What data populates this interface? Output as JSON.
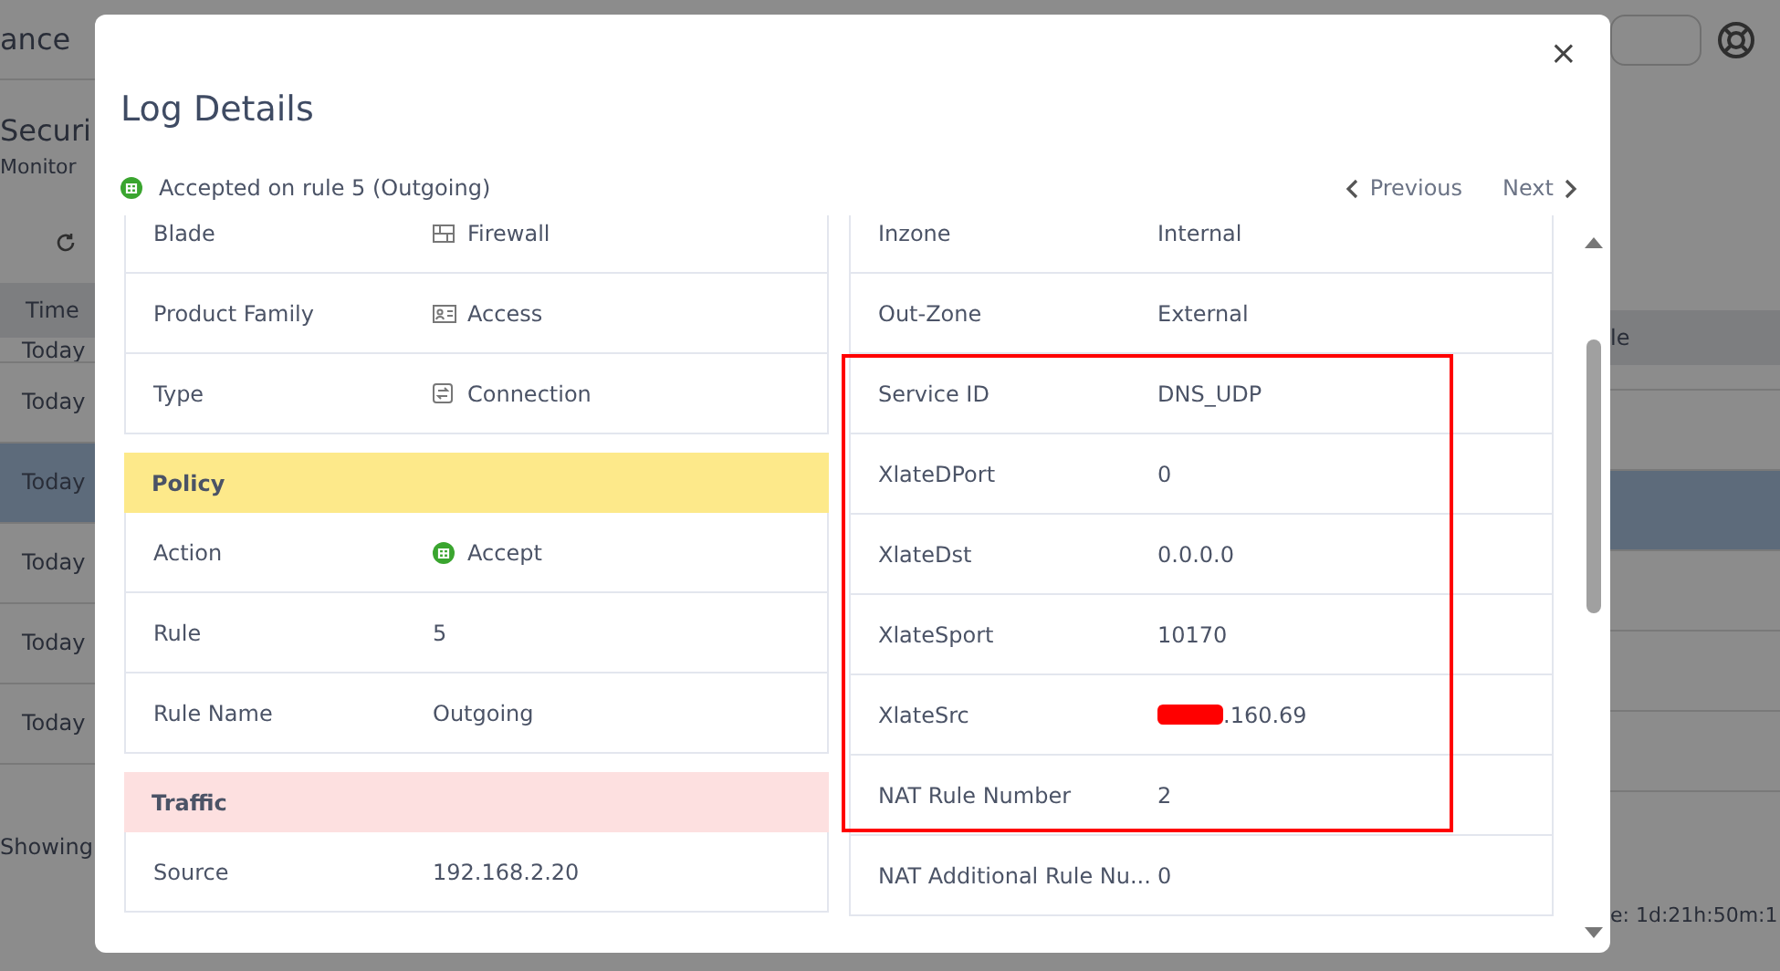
{
  "background": {
    "title": "ance",
    "heading": "Securi",
    "description": "Monitor",
    "column_1": "Time",
    "column_2": "le",
    "rows": [
      {
        "time": "Today",
        "selected": false
      },
      {
        "time": "Today",
        "selected": false
      },
      {
        "time": "Today",
        "selected": true
      },
      {
        "time": "Today",
        "selected": false
      },
      {
        "time": "Today",
        "selected": false
      },
      {
        "time": "Today",
        "selected": false
      }
    ],
    "footer": "Showing",
    "uptime": "e: 1d:21h:50m:1"
  },
  "dialog": {
    "title": "Log Details",
    "close": "×",
    "status": "Accepted on rule 5 (Outgoing)",
    "previous": "Previous",
    "next": "Next",
    "left": [
      {
        "kind": "row",
        "label": "Blade",
        "value": "Firewall",
        "icon": true
      },
      {
        "kind": "row",
        "label": "Product Family",
        "value": "Access",
        "icon": true
      },
      {
        "kind": "row",
        "label": "Type",
        "value": "Connection",
        "icon": true
      },
      {
        "kind": "header",
        "label": "Policy",
        "color": "#fde98a"
      },
      {
        "kind": "row",
        "label": "Action",
        "value": "Accept",
        "icon": true
      },
      {
        "kind": "row",
        "label": "Rule",
        "value": "5"
      },
      {
        "kind": "row",
        "label": "Rule Name",
        "value": "Outgoing"
      },
      {
        "kind": "header",
        "label": "Traffic",
        "color": "#fde0e0"
      },
      {
        "kind": "row",
        "label": "Source",
        "value": "192.168.2.20"
      }
    ],
    "right": [
      {
        "kind": "row",
        "label": "Inzone",
        "value": "Internal"
      },
      {
        "kind": "row",
        "label": "Out-Zone",
        "value": "External"
      },
      {
        "kind": "highlight",
        "rows": [
          {
            "label": "Service ID",
            "value": "DNS_UDP"
          },
          {
            "label": "XlateDPort",
            "value": "0"
          },
          {
            "label": "XlateDst",
            "value": "0.0.0.0"
          },
          {
            "label": "XlateSport",
            "value": "10170"
          },
          {
            "label": "XlateSrc",
            "value": ".160.69",
            "redacted": true
          },
          {
            "label": "NAT Rule Number",
            "value": "2"
          }
        ]
      },
      {
        "kind": "row",
        "label": "NAT Additional Rule Nu...",
        "value": "0"
      }
    ]
  }
}
